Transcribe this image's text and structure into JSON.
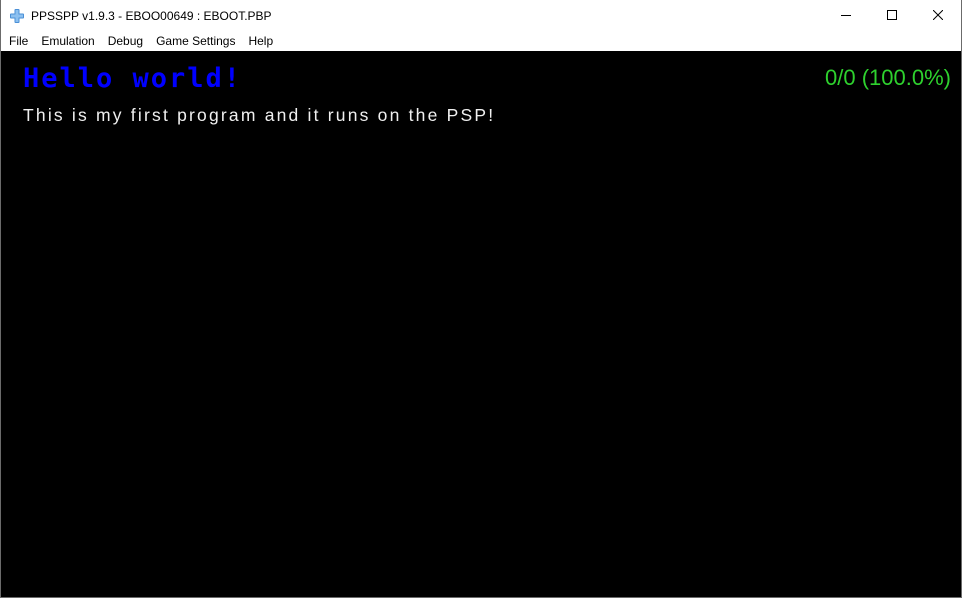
{
  "window": {
    "title": "PPSSPP v1.9.3 - EBOO00649 : EBOOT.PBP",
    "icon": "ppsspp-logo-icon",
    "controls": [
      "minimize-icon",
      "maximize-icon",
      "close-icon"
    ]
  },
  "menubar": {
    "items": [
      "File",
      "Emulation",
      "Debug",
      "Game Settings",
      "Help"
    ]
  },
  "game_screen": {
    "heading": "Hello world!",
    "line": "This is my first program and it runs on the PSP!",
    "fps_counter": "0/0 (100.0%)",
    "colors": {
      "background": "#000000",
      "heading": "#0000ff",
      "line": "#f0f0f0",
      "fps": "#2ed12e"
    }
  }
}
